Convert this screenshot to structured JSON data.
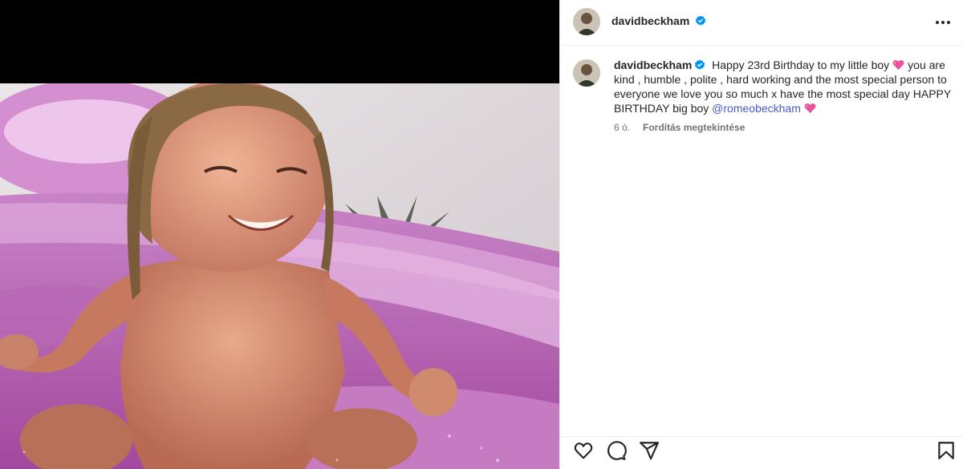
{
  "post": {
    "username": "davidbeckham",
    "verified": true,
    "caption_part1": "Happy 23rd Birthday to my little boy",
    "caption_part2": "you are kind , humble , polite , hard working and the most special person to everyone we love you so much x have the most special day HAPPY BIRTHDAY big boy",
    "mention": "@romeobeckham",
    "time_ago": "6 ó.",
    "translate_label": "Fordítás megtekintése"
  },
  "icons": {
    "more": "more-options-icon",
    "like": "heart-icon",
    "comment": "comment-icon",
    "share": "share-icon",
    "save": "bookmark-icon"
  },
  "colors": {
    "verified_badge": "#0095f6",
    "mention": "#4b58c6",
    "heart_emoji": "#e8549b"
  }
}
